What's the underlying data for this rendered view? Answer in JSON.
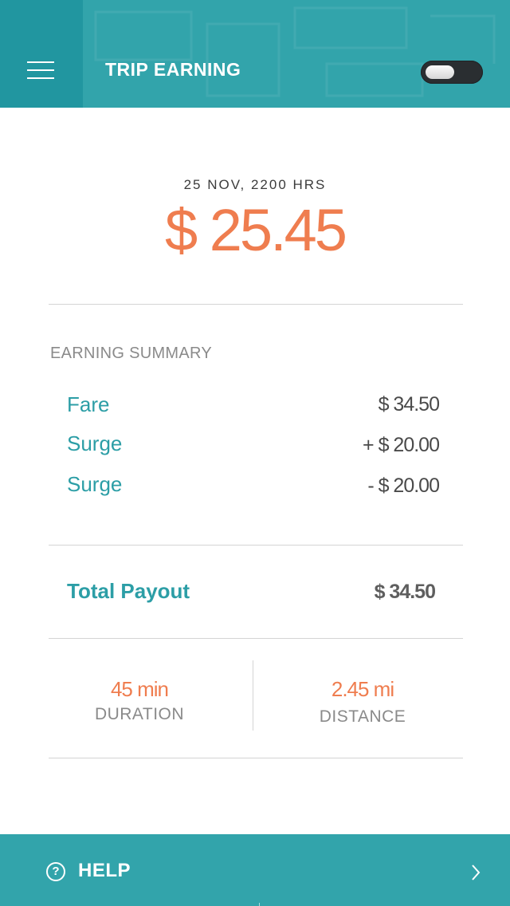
{
  "header": {
    "title": "TRIP EARNING",
    "menu_icon": "hamburger-menu-icon",
    "toggle_state": "off"
  },
  "trip": {
    "datetime": "25 NOV, 2200 HRS",
    "amount": "$ 25.45"
  },
  "summary": {
    "title": "EARNING SUMMARY",
    "rows": [
      {
        "label": "Fare",
        "value": "$ 34.50"
      },
      {
        "label": "Surge",
        "value": "+ $ 20.00"
      },
      {
        "label": "Surge",
        "value": "- $ 20.00"
      }
    ],
    "total_label": "Total Payout",
    "total_value": "$ 34.50"
  },
  "stats": {
    "duration_value": "45 min",
    "duration_label": "DURATION",
    "distance_value": "2.45 mi",
    "distance_label": "DISTANCE"
  },
  "footer": {
    "help_label": "HELP",
    "help_icon": "question-circle-icon",
    "chevron_icon": "chevron-right-icon"
  },
  "colors": {
    "teal": "#32a4ab",
    "teal_dark": "#2196a0",
    "accent": "#ef7d4f",
    "text_teal": "#2c9ea6"
  }
}
